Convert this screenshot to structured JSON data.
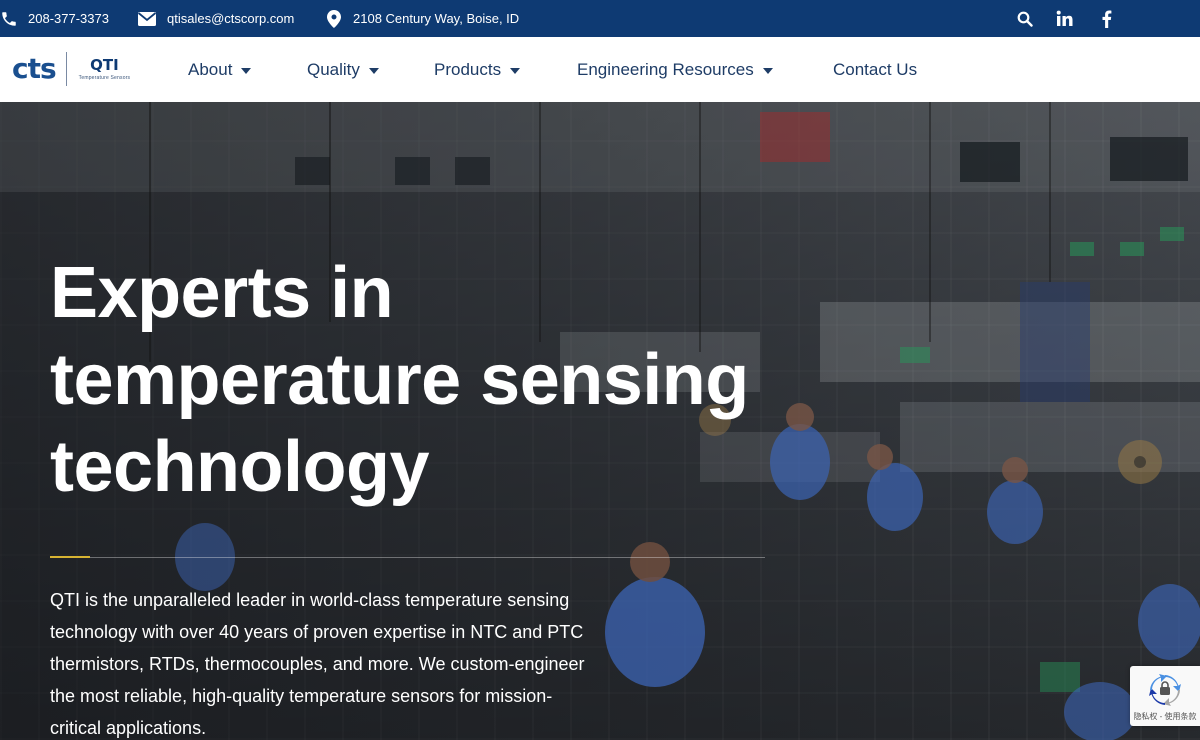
{
  "topbar": {
    "phone": "208-377-3373",
    "email": "qtisales@ctscorp.com",
    "address": "2108 Century Way, Boise, ID",
    "icons": [
      "phone-icon",
      "envelope-icon",
      "map-marker-icon",
      "search-icon",
      "linkedin-icon",
      "facebook-icon"
    ]
  },
  "logo": {
    "primary": "cts",
    "secondary": "QTI",
    "tagline": "Temperature Sensors"
  },
  "nav": {
    "items": [
      {
        "label": "About",
        "has_dropdown": true
      },
      {
        "label": "Quality",
        "has_dropdown": true
      },
      {
        "label": "Products",
        "has_dropdown": true
      },
      {
        "label": "Engineering Resources",
        "has_dropdown": true
      },
      {
        "label": "Contact Us",
        "has_dropdown": false
      }
    ]
  },
  "hero": {
    "heading_lines": [
      "Experts in",
      "temperature sensing",
      "technology"
    ],
    "lead_lines": [
      "QTI is the unparalleled leader in world-class temperature sensing",
      "technology with over 40 years of proven expertise in NTC and PTC",
      "thermistors, RTDs, thermocouples, and more. We custom-engineer",
      "the most reliable, high-quality temperature sensors for mission-",
      "critical applications."
    ]
  },
  "recaptcha": {
    "text": "隐私权 - 使用条款"
  },
  "colors": {
    "topbar_bg": "#0e3a73",
    "nav_text": "#1e3c66",
    "accent_gold": "#d7b332",
    "logo_blue": "#1a4f8f"
  }
}
